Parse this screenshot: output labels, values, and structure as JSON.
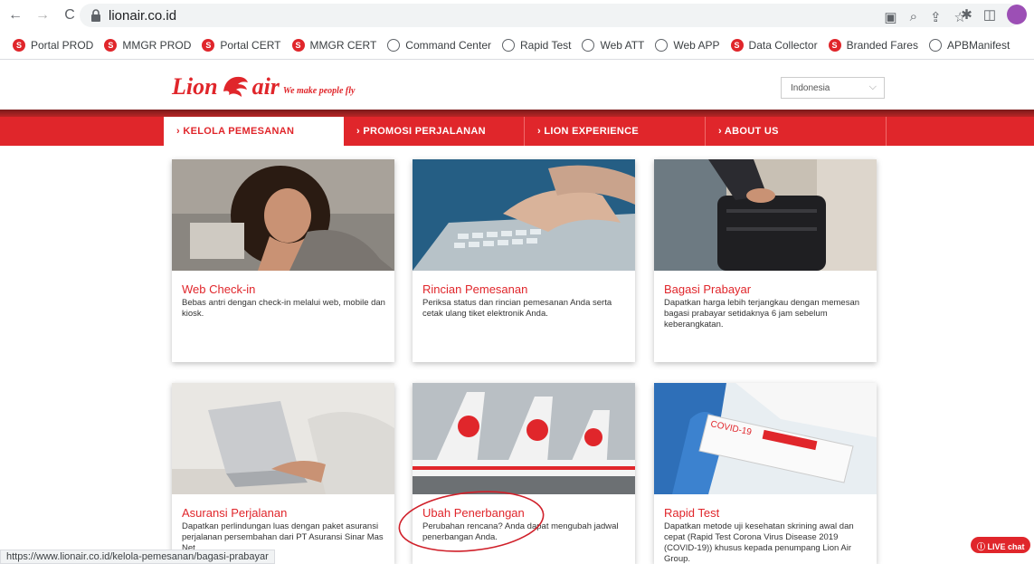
{
  "browser": {
    "url": "lionair.co.id",
    "status_url": "https://www.lionair.co.id/kelola-pemesanan/bagasi-prabayar"
  },
  "bookmarks": [
    {
      "label": "Portal PROD",
      "icon": "lion-red-icon"
    },
    {
      "label": "MMGR PROD",
      "icon": "lion-red-icon"
    },
    {
      "label": "Portal CERT",
      "icon": "lion-red-icon"
    },
    {
      "label": "MMGR CERT",
      "icon": "lion-red-icon"
    },
    {
      "label": "Command Center",
      "icon": "globe-icon"
    },
    {
      "label": "Rapid Test",
      "icon": "globe-icon"
    },
    {
      "label": "Web ATT",
      "icon": "globe-icon"
    },
    {
      "label": "Web APP",
      "icon": "globe-icon"
    },
    {
      "label": "Data Collector",
      "icon": "lion-red-icon"
    },
    {
      "label": "Branded Fares",
      "icon": "lion-red-icon"
    },
    {
      "label": "APBManifest",
      "icon": "globe-icon"
    }
  ],
  "header": {
    "logo_left": "Lion",
    "logo_right": "air",
    "tagline": "We make people fly",
    "language": "Indonesia"
  },
  "menu": [
    {
      "label": "› KELOLA PEMESANAN",
      "active": true
    },
    {
      "label": "› PROMOSI PERJALANAN",
      "active": false
    },
    {
      "label": "› LION EXPERIENCE",
      "active": false
    },
    {
      "label": "› ABOUT US",
      "active": false
    }
  ],
  "cards": [
    {
      "title": "Web Check-in",
      "desc": "Bebas antri dengan check-in melalui web, mobile dan kiosk."
    },
    {
      "title": "Rincian Pemesanan",
      "desc": "Periksa status dan rincian pemesanan Anda serta cetak ulang tiket elektronik Anda."
    },
    {
      "title": "Bagasi Prabayar",
      "desc": "Dapatkan harga lebih terjangkau dengan memesan bagasi prabayar setidaknya 6 jam sebelum keberangkatan."
    },
    {
      "title": "Asuransi Perjalanan",
      "desc": "Dapatkan perlindungan luas dengan paket asuransi perjalanan persembahan dari PT Asuransi Sinar Mas Net"
    },
    {
      "title": "Ubah Penerbangan",
      "desc": "Perubahan rencana? Anda dapat mengubah jadwal penerbangan Anda."
    },
    {
      "title": "Rapid Test",
      "desc": "Dapatkan metode uji kesehatan skrining awal dan cepat (Rapid Test Corona Virus Disease 2019 (COVID-19)) khusus kepada penumpang Lion Air Group."
    }
  ],
  "image_text": {
    "covid_label": "COVID-19"
  },
  "live_chat": "LIVE chat",
  "colors": {
    "brand_red": "#e0262b"
  }
}
